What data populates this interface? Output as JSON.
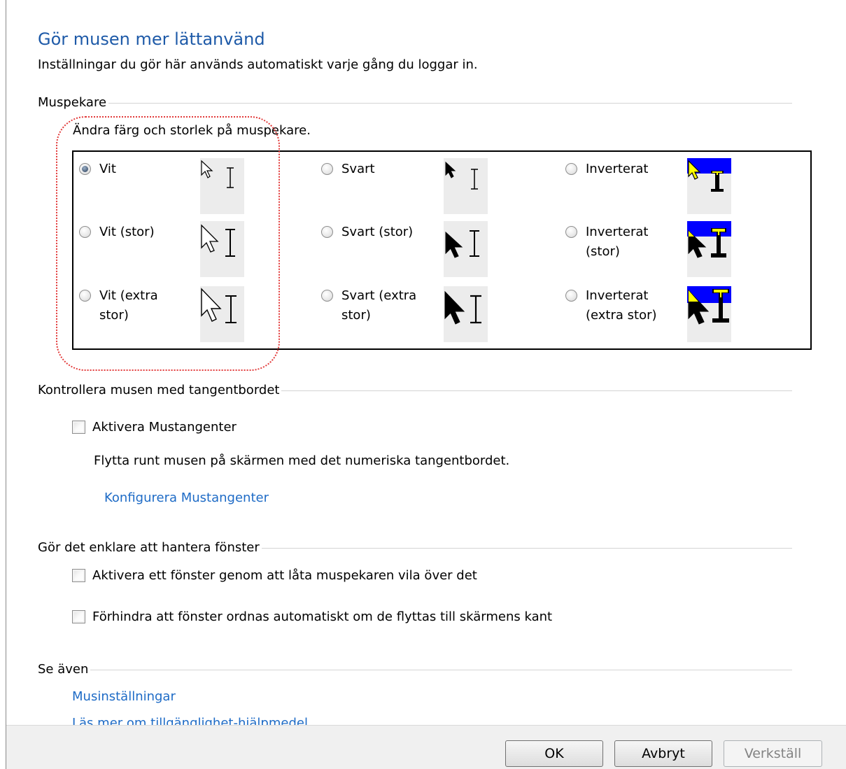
{
  "header": {
    "title": "Gör musen mer lättanvänd",
    "subtitle": "Inställningar du gör här används automatiskt varje gång du loggar in."
  },
  "pointer_section": {
    "label": "Muspekare",
    "description": "Ändra färg och storlek på muspekare.",
    "options": [
      {
        "label": "Vit",
        "checked": true
      },
      {
        "label": "Svart",
        "checked": false
      },
      {
        "label": "Inverterat",
        "checked": false
      },
      {
        "label": "Vit (stor)",
        "checked": false
      },
      {
        "label": "Svart (stor)",
        "checked": false
      },
      {
        "label_line1": "Inverterat",
        "label_line2": "(stor)",
        "checked": false
      },
      {
        "label_line1": "Vit (extra",
        "label_line2": "stor)",
        "checked": false
      },
      {
        "label_line1": "Svart (extra",
        "label_line2": "stor)",
        "checked": false
      },
      {
        "label_line1": "Inverterat",
        "label_line2": "(extra stor)",
        "checked": false
      }
    ],
    "colors": {
      "highlight_blue": "#0000ff",
      "highlight_yellow": "#ffff00",
      "focus_ring": "#e23a3a"
    }
  },
  "keyboard_section": {
    "label": "Kontrollera musen med tangentbordet",
    "mousekeys_checkbox": "Aktivera Mustangenter",
    "mousekeys_checked": false,
    "mousekeys_hint": "Flytta runt musen på skärmen med det numeriska tangentbordet.",
    "configure_link": "Konfigurera Mustangenter"
  },
  "windows_section": {
    "label": "Gör det enklare att hantera fönster",
    "hover_activate": "Aktivera ett fönster genom att låta muspekaren vila över det",
    "prevent_arrange": "Förhindra att fönster ordnas automatiskt om de flyttas till skärmens kant"
  },
  "see_also": {
    "label": "Se även",
    "links": [
      "Musinställningar",
      "Läs mer om tillgänglighet-hjälpmedel"
    ]
  },
  "footer": {
    "ok": "OK",
    "cancel": "Avbryt",
    "apply": "Verkställ"
  },
  "accent_colors": {
    "title": "#1e5aa8",
    "link": "#1e6bc6"
  }
}
